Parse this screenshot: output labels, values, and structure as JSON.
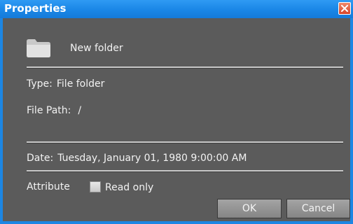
{
  "window": {
    "title": "Properties",
    "close_icon": "close-icon",
    "accent_color": "#1c86e3"
  },
  "item": {
    "icon": "folder-icon",
    "name": "New folder"
  },
  "details": {
    "type_label": "Type:",
    "type_value": "File folder",
    "path_label": "File Path:",
    "path_value": "/",
    "date_label": "Date:",
    "date_value": "Tuesday, January 01, 1980 9:00:00 AM"
  },
  "attributes": {
    "label": "Attribute",
    "read_only_label": "Read only",
    "read_only_checked": false
  },
  "buttons": {
    "ok": "OK",
    "cancel": "Cancel"
  }
}
